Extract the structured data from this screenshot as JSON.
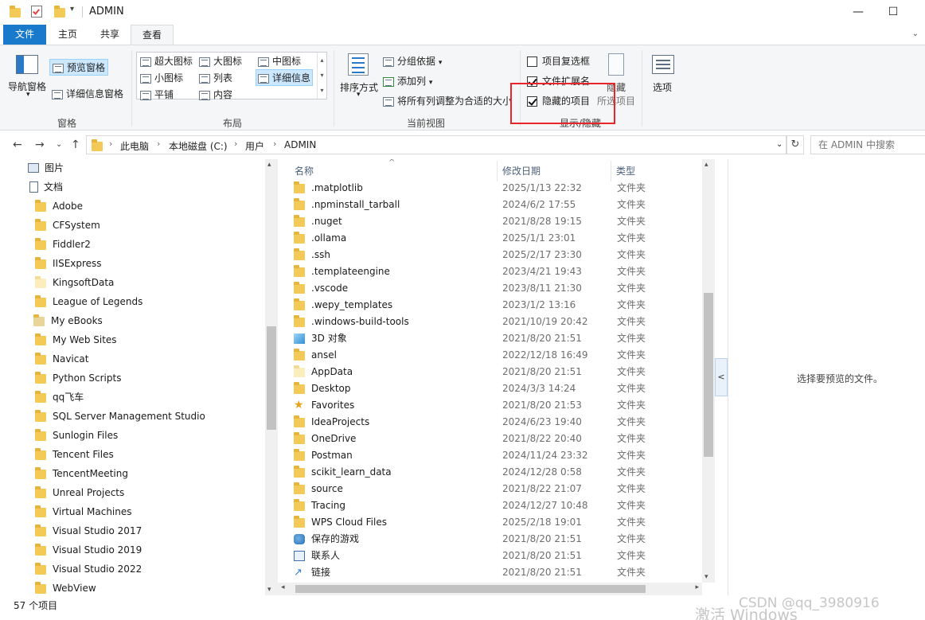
{
  "window": {
    "title": "ADMIN",
    "minimize": "—",
    "maximize": "☐"
  },
  "tabs": {
    "file": "文件",
    "home": "主页",
    "share": "共享",
    "view": "查看"
  },
  "ribbon": {
    "panes": {
      "nav_pane": "导航窗格",
      "preview_pane": "预览窗格",
      "details_pane": "详细信息窗格",
      "group": "窗格"
    },
    "layout": {
      "extra_large": "超大图标",
      "large": "大图标",
      "medium": "中图标",
      "small": "小图标",
      "list": "列表",
      "details": "详细信息",
      "tiles": "平铺",
      "content": "内容",
      "group": "布局"
    },
    "current_view": {
      "sort_by": "排序方式",
      "group_by": "分组依据",
      "add_columns": "添加列",
      "fit_columns": "将所有列调整为合适的大小",
      "group": "当前视图"
    },
    "show_hide": {
      "item_checkboxes": "项目复选框",
      "file_extensions": "文件扩展名",
      "hidden_items": "隐藏的项目",
      "hide": "隐藏",
      "selected_items": "所选项目",
      "group": "显示/隐藏",
      "item_checkboxes_checked": false,
      "file_extensions_checked": true,
      "hidden_items_checked": true
    },
    "options": "选项"
  },
  "address": {
    "crumbs": [
      "此电脑",
      "本地磁盘 (C:)",
      "用户",
      "ADMIN"
    ],
    "search_placeholder": "在 ADMIN 中搜索"
  },
  "nav_items": [
    {
      "label": "图片",
      "icon": "pictures-icon"
    },
    {
      "label": "文档",
      "icon": "documents-icon"
    },
    {
      "label": "Adobe",
      "icon": "folder-icon"
    },
    {
      "label": "CFSystem",
      "icon": "folder-icon"
    },
    {
      "label": "Fiddler2",
      "icon": "folder-icon"
    },
    {
      "label": "IISExpress",
      "icon": "folder-icon"
    },
    {
      "label": "KingsoftData",
      "icon": "folder-hidden-icon"
    },
    {
      "label": "League of Legends",
      "icon": "folder-icon"
    },
    {
      "label": "My eBooks",
      "icon": "ebooks-folder-icon"
    },
    {
      "label": "My Web Sites",
      "icon": "folder-icon"
    },
    {
      "label": "Navicat",
      "icon": "folder-icon"
    },
    {
      "label": "Python Scripts",
      "icon": "folder-icon"
    },
    {
      "label": "qq飞车",
      "icon": "folder-icon"
    },
    {
      "label": "SQL Server Management Studio",
      "icon": "folder-icon"
    },
    {
      "label": "Sunlogin Files",
      "icon": "folder-icon"
    },
    {
      "label": "Tencent Files",
      "icon": "folder-icon"
    },
    {
      "label": "TencentMeeting",
      "icon": "folder-icon"
    },
    {
      "label": "Unreal Projects",
      "icon": "folder-icon"
    },
    {
      "label": "Virtual Machines",
      "icon": "folder-icon"
    },
    {
      "label": "Visual Studio 2017",
      "icon": "folder-icon"
    },
    {
      "label": "Visual Studio 2019",
      "icon": "folder-icon"
    },
    {
      "label": "Visual Studio 2022",
      "icon": "folder-icon"
    },
    {
      "label": "WebView",
      "icon": "folder-icon"
    }
  ],
  "columns": {
    "name": "名称",
    "modified": "修改日期",
    "type": "类型"
  },
  "files": [
    {
      "name": ".matplotlib",
      "date": "2025/1/13 22:32",
      "type": "文件夹",
      "icon": "folder-icon"
    },
    {
      "name": ".npminstall_tarball",
      "date": "2024/6/2 17:55",
      "type": "文件夹",
      "icon": "folder-icon"
    },
    {
      "name": ".nuget",
      "date": "2021/8/28 19:15",
      "type": "文件夹",
      "icon": "folder-icon"
    },
    {
      "name": ".ollama",
      "date": "2025/1/1 23:01",
      "type": "文件夹",
      "icon": "folder-icon"
    },
    {
      "name": ".ssh",
      "date": "2025/2/17 23:30",
      "type": "文件夹",
      "icon": "folder-icon"
    },
    {
      "name": ".templateengine",
      "date": "2023/4/21 19:43",
      "type": "文件夹",
      "icon": "folder-icon"
    },
    {
      "name": ".vscode",
      "date": "2023/8/11 21:30",
      "type": "文件夹",
      "icon": "folder-icon"
    },
    {
      "name": ".wepy_templates",
      "date": "2023/1/2 13:16",
      "type": "文件夹",
      "icon": "folder-icon"
    },
    {
      "name": ".windows-build-tools",
      "date": "2021/10/19 20:42",
      "type": "文件夹",
      "icon": "folder-icon"
    },
    {
      "name": "3D 对象",
      "date": "2021/8/20 21:51",
      "type": "文件夹",
      "icon": "3d-objects-icon"
    },
    {
      "name": "ansel",
      "date": "2022/12/18 16:49",
      "type": "文件夹",
      "icon": "folder-icon"
    },
    {
      "name": "AppData",
      "date": "2021/8/20 21:51",
      "type": "文件夹",
      "icon": "folder-hidden-icon"
    },
    {
      "name": "Desktop",
      "date": "2024/3/3 14:24",
      "type": "文件夹",
      "icon": "folder-icon"
    },
    {
      "name": "Favorites",
      "date": "2021/8/20 21:53",
      "type": "文件夹",
      "icon": "favorites-star-icon"
    },
    {
      "name": "IdeaProjects",
      "date": "2024/6/23 19:40",
      "type": "文件夹",
      "icon": "folder-icon"
    },
    {
      "name": "OneDrive",
      "date": "2021/8/22 20:40",
      "type": "文件夹",
      "icon": "folder-icon"
    },
    {
      "name": "Postman",
      "date": "2024/11/24 23:32",
      "type": "文件夹",
      "icon": "folder-icon"
    },
    {
      "name": "scikit_learn_data",
      "date": "2024/12/28 0:58",
      "type": "文件夹",
      "icon": "folder-icon"
    },
    {
      "name": "source",
      "date": "2021/8/22 21:07",
      "type": "文件夹",
      "icon": "folder-icon"
    },
    {
      "name": "Tracing",
      "date": "2024/12/27 10:48",
      "type": "文件夹",
      "icon": "folder-icon"
    },
    {
      "name": "WPS Cloud Files",
      "date": "2025/2/18 19:01",
      "type": "文件夹",
      "icon": "folder-icon"
    },
    {
      "name": "保存的游戏",
      "date": "2021/8/20 21:51",
      "type": "文件夹",
      "icon": "saved-games-icon"
    },
    {
      "name": "联系人",
      "date": "2021/8/20 21:51",
      "type": "文件夹",
      "icon": "contacts-icon"
    },
    {
      "name": "链接",
      "date": "2021/8/20 21:51",
      "type": "文件夹",
      "icon": "links-icon"
    }
  ],
  "preview_text": "选择要预览的文件。",
  "status": {
    "count": "57 个项目"
  },
  "watermarks": {
    "activate": "激活 Windows",
    "csdn": "CSDN @qq_3980916"
  },
  "colors": {
    "accent": "#1979ca",
    "folder": "#f3c957",
    "highlight_box": "#e8262a",
    "selected": "#cce8ff"
  }
}
